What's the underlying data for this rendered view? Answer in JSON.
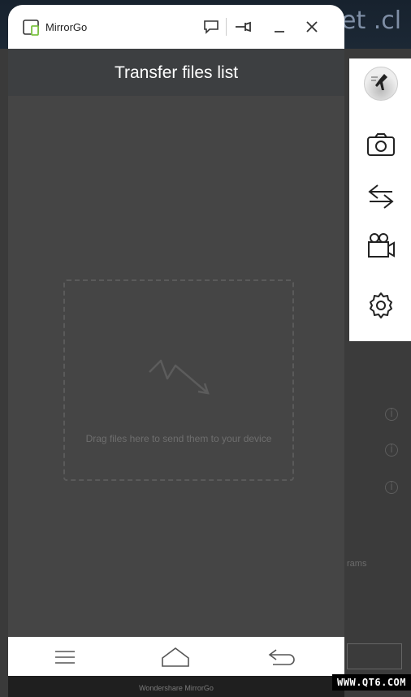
{
  "background_app": {
    "title_fragment": "et .cl",
    "programs_fragment": "rams"
  },
  "window": {
    "app_name": "MirrorGo",
    "header_title": "Transfer files list",
    "footer_brand": "Wondershare MirrorGo"
  },
  "titlebar_buttons": [
    "feedback-icon",
    "pin-icon",
    "minimize-icon",
    "close-icon"
  ],
  "dropzone": {
    "text": "Drag files here to send them to your device"
  },
  "toolbar": [
    "avatar",
    "screenshot-camera-icon",
    "transfer-icon",
    "record-video-icon",
    "settings-icon"
  ],
  "navbar": [
    "menu-icon",
    "home-icon",
    "back-icon"
  ],
  "watermark": "WWW.QT6.COM",
  "colors": {
    "phone_body": "#454545",
    "header": "#3d3f41",
    "logo_green": "#7cc242"
  }
}
